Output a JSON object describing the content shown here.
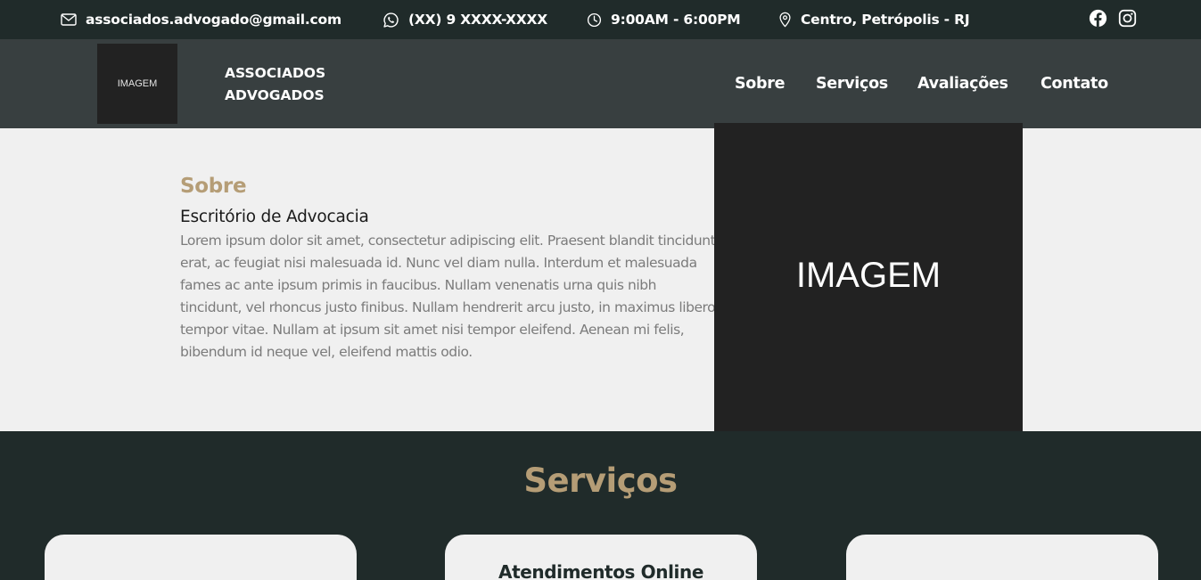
{
  "topbar": {
    "email": "associados.advogado@gmail.com",
    "email_icon": "mail-icon",
    "phone": "(XX) 9 XXXX-XXXX",
    "phone_icon": "whatsapp-icon",
    "hours": "9:00AM - 6:00PM",
    "hours_icon": "clock-icon",
    "location": "Centro, Petrópolis - RJ",
    "location_icon": "map-pin-icon",
    "social": [
      "facebook-icon",
      "instagram-icon"
    ]
  },
  "header": {
    "logo_text": "IMAGEM",
    "brand_line1": "ASSOCIADOS",
    "brand_line2": "ADVOGADOS",
    "nav": [
      {
        "label": "Sobre"
      },
      {
        "label": "Serviços"
      },
      {
        "label": "Avaliações"
      },
      {
        "label": "Contato"
      }
    ]
  },
  "about": {
    "kicker": "Sobre",
    "title": "Escritório de Advocacia",
    "text": "Lorem ipsum dolor sit amet, consectetur adipiscing elit. Praesent blandit tincidunt erat, ac feugiat nisi malesuada id. Nunc vel diam nulla. Interdum et malesuada fames ac ante ipsum primis in faucibus. Nullam venenatis urna quis nibh tincidunt, vel rhoncus justo finibus. Nullam hendrerit arcu justo, in maximus libero tempor vitae. Nullam at ipsum sit amet nisi tempor eleifend. Aenean mi felis, bibendum id neque vel, eleifend mattis odio.",
    "image_text": "IMAGEM"
  },
  "services": {
    "title": "Serviços",
    "cards": [
      {
        "title": ""
      },
      {
        "title": "Atendimentos Online"
      },
      {
        "title": ""
      }
    ]
  },
  "colors": {
    "dark_green": "#202b2a",
    "nav_gray": "#383f40",
    "gold": "#b59d76",
    "light_bg": "#f0f0f0",
    "image_bg": "#222222"
  }
}
